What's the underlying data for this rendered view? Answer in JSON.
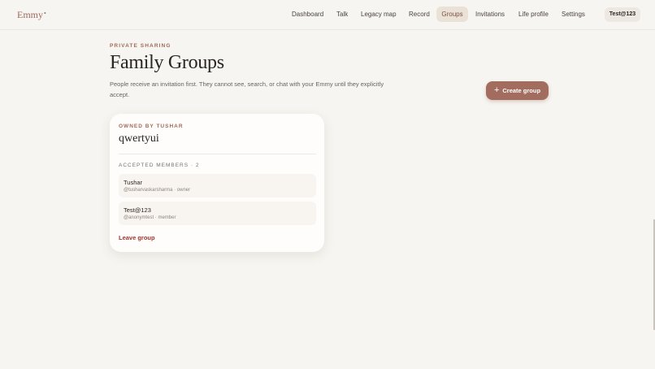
{
  "app": {
    "logo": "Emmy",
    "logo_dot": "•"
  },
  "nav": {
    "items": [
      {
        "label": "Dashboard",
        "active": false
      },
      {
        "label": "Talk",
        "active": false
      },
      {
        "label": "Legacy map",
        "active": false
      },
      {
        "label": "Record",
        "active": false
      },
      {
        "label": "Groups",
        "active": true
      },
      {
        "label": "Invitations",
        "active": false
      },
      {
        "label": "Life profile",
        "active": false
      },
      {
        "label": "Settings",
        "active": false
      }
    ],
    "user": "Test@123"
  },
  "header": {
    "eyebrow": "PRIVATE SHARING",
    "title": "Family Groups",
    "description": "People receive an invitation first. They cannot see, search, or chat with your Emmy until they explicitly accept."
  },
  "actions": {
    "create_group": "Create group",
    "create_icon": "plus-icon"
  },
  "group": {
    "owner_label": "OWNED BY TUSHAR",
    "name": "qwertyui",
    "members_label": "ACCEPTED MEMBERS · 2",
    "members": [
      {
        "name": "Tushar",
        "meta": "@tusharvaskarsharma · owner"
      },
      {
        "name": "Test@123",
        "meta": "@anonymtest · member"
      }
    ],
    "leave_label": "Leave group"
  },
  "colors": {
    "background": "#f7f5f1",
    "accent": "#a26d5e",
    "active_nav": "#ebe2d7",
    "danger": "#a3352c"
  }
}
